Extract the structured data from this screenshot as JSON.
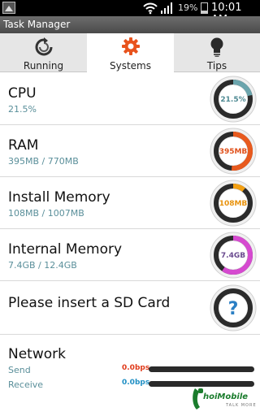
{
  "status_bar": {
    "battery_percent": "19%",
    "time": "10:01 AM"
  },
  "app_title": "Task Manager",
  "tabs": [
    {
      "label": "Running",
      "icon": "refresh-icon",
      "active": false
    },
    {
      "label": "Systems",
      "icon": "gear-icon",
      "active": true
    },
    {
      "label": "Tips",
      "icon": "lightbulb-icon",
      "active": false
    }
  ],
  "items": [
    {
      "title": "CPU",
      "subtitle": "21.5%",
      "gauge_label": "21.5%",
      "fraction": 0.215,
      "color": "#6ba5ad",
      "label_color": "#4f8a93"
    },
    {
      "title": "RAM",
      "subtitle": "395MB / 770MB",
      "gauge_label": "395MB",
      "fraction": 0.513,
      "color": "#e85a1e",
      "label_color": "#e0501a"
    },
    {
      "title": "Install Memory",
      "subtitle": "108MB / 1007MB",
      "gauge_label": "108MB",
      "fraction": 0.107,
      "color": "#f3a012",
      "label_color": "#e8920c"
    },
    {
      "title": "Internal Memory",
      "subtitle": "7.4GB / 12.4GB",
      "gauge_label": "7.4GB",
      "fraction": 0.597,
      "color": "#d64ad0",
      "label_color": "#6a4a8f"
    }
  ],
  "sd_card": {
    "title": "Please insert a SD Card",
    "icon": "question-icon",
    "color": "#2b7fc4"
  },
  "network": {
    "title": "Network",
    "send_label": "Send",
    "receive_label": "Receive",
    "send_rate": "0.0bps",
    "receive_rate": "0.0bps",
    "send_color": "#e03a1a",
    "receive_color": "#1f8fc4"
  },
  "watermark": {
    "text": "hoiMobile",
    "sub": "TALK MORE"
  }
}
